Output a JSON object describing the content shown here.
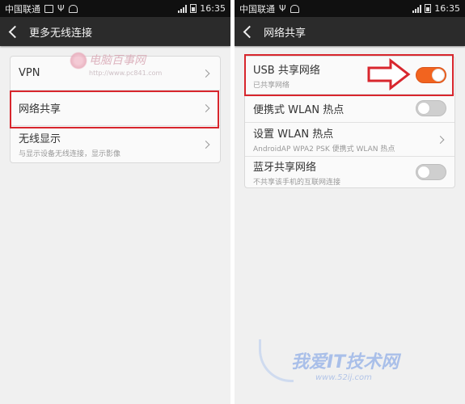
{
  "left_screen": {
    "status": {
      "carrier": "中国联通",
      "time": "16:35"
    },
    "title": "更多无线连接",
    "items": [
      {
        "label": "VPN"
      },
      {
        "label": "网络共享"
      },
      {
        "label": "无线显示",
        "sub": "与显示设备无线连接，显示影像"
      }
    ],
    "watermark": {
      "text": "电脑百事网",
      "url": "http://www.pc841.com"
    }
  },
  "right_screen": {
    "status": {
      "carrier": "中国联通",
      "time": "16:35"
    },
    "title": "网络共享",
    "items": [
      {
        "label": "USB 共享网络",
        "sub": "已共享网络",
        "toggle": "on"
      },
      {
        "label": "便携式 WLAN 热点",
        "toggle": "off"
      },
      {
        "label": "设置 WLAN 热点",
        "sub": "AndroidAP WPA2 PSK 便携式 WLAN 热点"
      },
      {
        "label": "蓝牙共享网络",
        "sub": "不共享该手机的互联网连接",
        "toggle": "off"
      }
    ],
    "watermark": {
      "text": "我爱IT技术网",
      "url": "www.52ij.com"
    }
  },
  "colors": {
    "highlight_box": "#d8262d",
    "toggle_on": "#f2641f",
    "titlebar": "#2b2b2b"
  }
}
